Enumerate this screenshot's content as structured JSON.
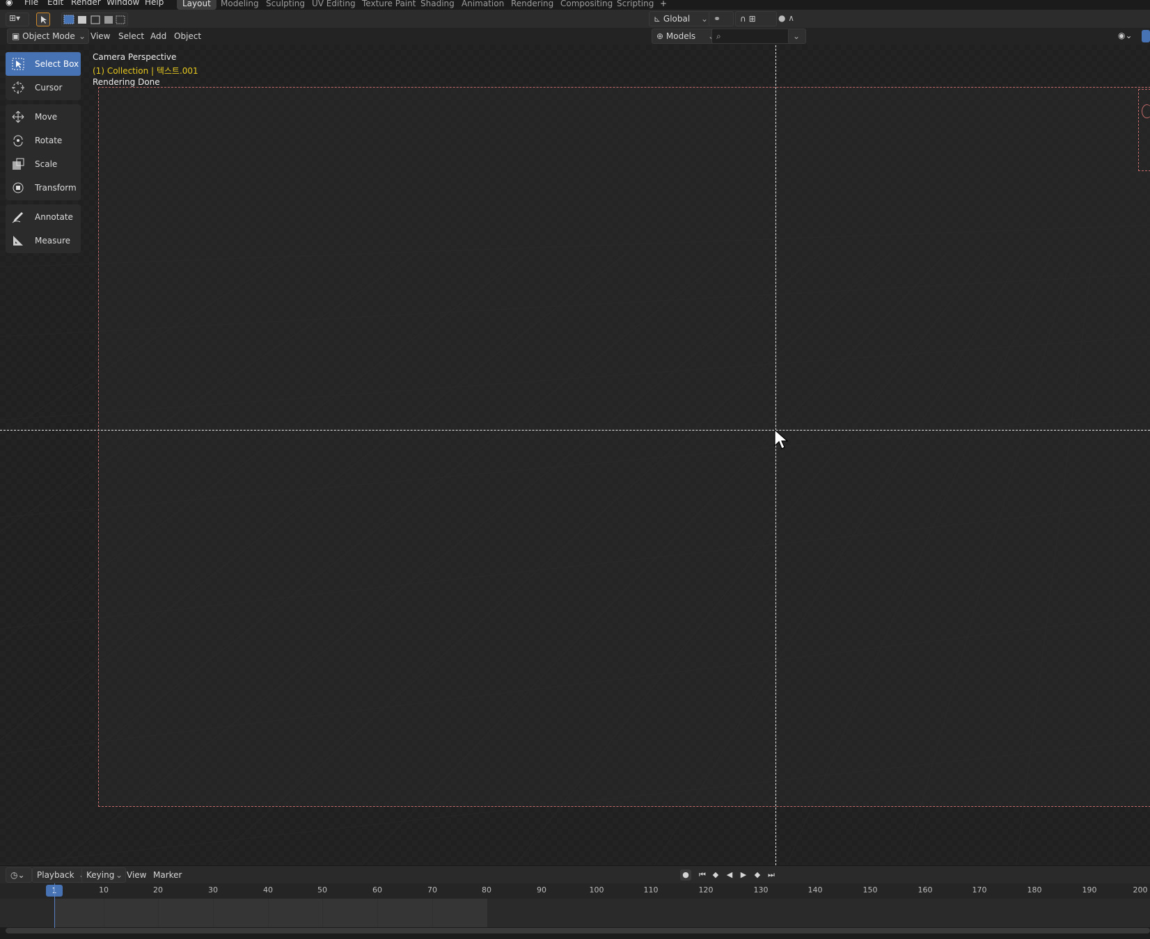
{
  "top_menu": {
    "logo_icon": "blender-icon",
    "items": [
      "File",
      "Edit",
      "Render",
      "Window",
      "Help"
    ],
    "workspaces": [
      "Layout",
      "Modeling",
      "Sculpting",
      "UV Editing",
      "Texture Paint",
      "Shading",
      "Animation",
      "Rendering",
      "Compositing",
      "Scripting"
    ],
    "active_workspace": "Layout",
    "add_workspace": "+"
  },
  "tool_header": {
    "orientation": "Global"
  },
  "viewport_header": {
    "mode": "Object Mode",
    "menus": [
      "View",
      "Select",
      "Add",
      "Object"
    ],
    "collection_dropdown": "Models",
    "search_placeholder": ""
  },
  "toolbar": {
    "tools": [
      "Select Box",
      "Cursor",
      "Move",
      "Rotate",
      "Scale",
      "Transform",
      "Annotate",
      "Measure"
    ],
    "active_tool": "Select Box"
  },
  "viewport": {
    "view_name": "Camera Perspective",
    "collection_info": "(1) Collection | 텍스트.001",
    "status": "Rendering Done",
    "colors": {
      "collection_info": "#e6c81f",
      "frame_border": "#c56a6a"
    }
  },
  "timeline": {
    "menus": [
      "Playback",
      "Keying",
      "View",
      "Marker"
    ],
    "current_frame": "1",
    "ticks": [
      "10",
      "20",
      "30",
      "40",
      "50",
      "60",
      "70",
      "80",
      "90",
      "100",
      "110",
      "120",
      "130",
      "140",
      "150",
      "160",
      "170",
      "180",
      "190",
      "200"
    ]
  }
}
